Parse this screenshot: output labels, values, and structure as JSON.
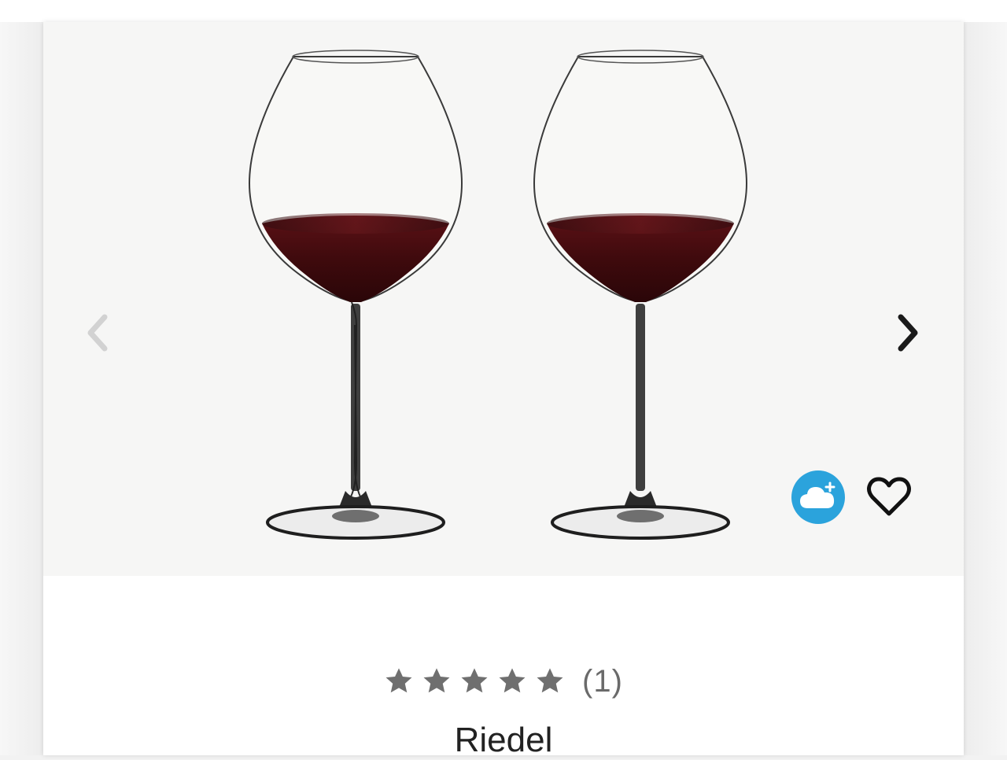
{
  "product": {
    "brand": "Riedel",
    "rating": {
      "stars": 5,
      "max_stars": 5,
      "review_count_label": "(1)"
    },
    "image": {
      "alt_description": "",
      "wine_color": "#4a0d10"
    }
  },
  "gallery": {
    "prev_icon": "chevron-left-icon",
    "next_icon": "chevron-right-icon"
  },
  "actions": {
    "cloud_icon": "cloud-plus-icon",
    "cloud_color": "#2ba3dc",
    "favorite_icon": "heart-outline-icon"
  },
  "colors": {
    "star": "#6f6f6f",
    "prev_arrow": "#d2d2d2",
    "next_arrow": "#1a1a1a"
  }
}
